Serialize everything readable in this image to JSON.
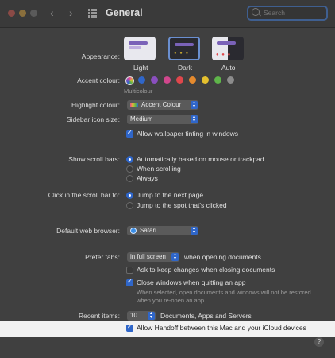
{
  "window": {
    "title": "General"
  },
  "search": {
    "placeholder": "Search"
  },
  "appearance": {
    "label": "Appearance:",
    "options": [
      "Light",
      "Dark",
      "Auto"
    ]
  },
  "accent": {
    "label": "Accent colour:",
    "sub_label": "Multicolour",
    "colors": [
      "#e24a8f",
      "#2f66c9",
      "#8a4fbf",
      "#d1478d",
      "#e0474c",
      "#e58a2e",
      "#e5c02e",
      "#5fb54a",
      "#8c8c8c"
    ]
  },
  "highlight": {
    "label": "Highlight colour:",
    "value": "Accent Colour"
  },
  "sidebar_icon": {
    "label": "Sidebar icon size:",
    "value": "Medium"
  },
  "wallpaper_tinting": {
    "label": "Allow wallpaper tinting in windows"
  },
  "scroll_bars": {
    "label": "Show scroll bars:",
    "options": [
      "Automatically based on mouse or trackpad",
      "When scrolling",
      "Always"
    ]
  },
  "click_scroll": {
    "label": "Click in the scroll bar to:",
    "options": [
      "Jump to the next page",
      "Jump to the spot that's clicked"
    ]
  },
  "browser": {
    "label": "Default web browser:",
    "value": "Safari"
  },
  "prefer_tabs": {
    "label": "Prefer tabs:",
    "value": "in full screen",
    "suffix": "when opening documents"
  },
  "ask_keep": {
    "label": "Ask to keep changes when closing documents"
  },
  "close_windows": {
    "label": "Close windows when quitting an app",
    "note_line1": "When selected, open documents and windows will not be restored",
    "note_line2": "when you re-open an app."
  },
  "recent_items": {
    "label": "Recent items:",
    "value": "10",
    "suffix": "Documents, Apps and Servers"
  },
  "handoff": {
    "label": "Allow Handoff between this Mac and your iCloud devices"
  },
  "help": {
    "label": "?"
  }
}
